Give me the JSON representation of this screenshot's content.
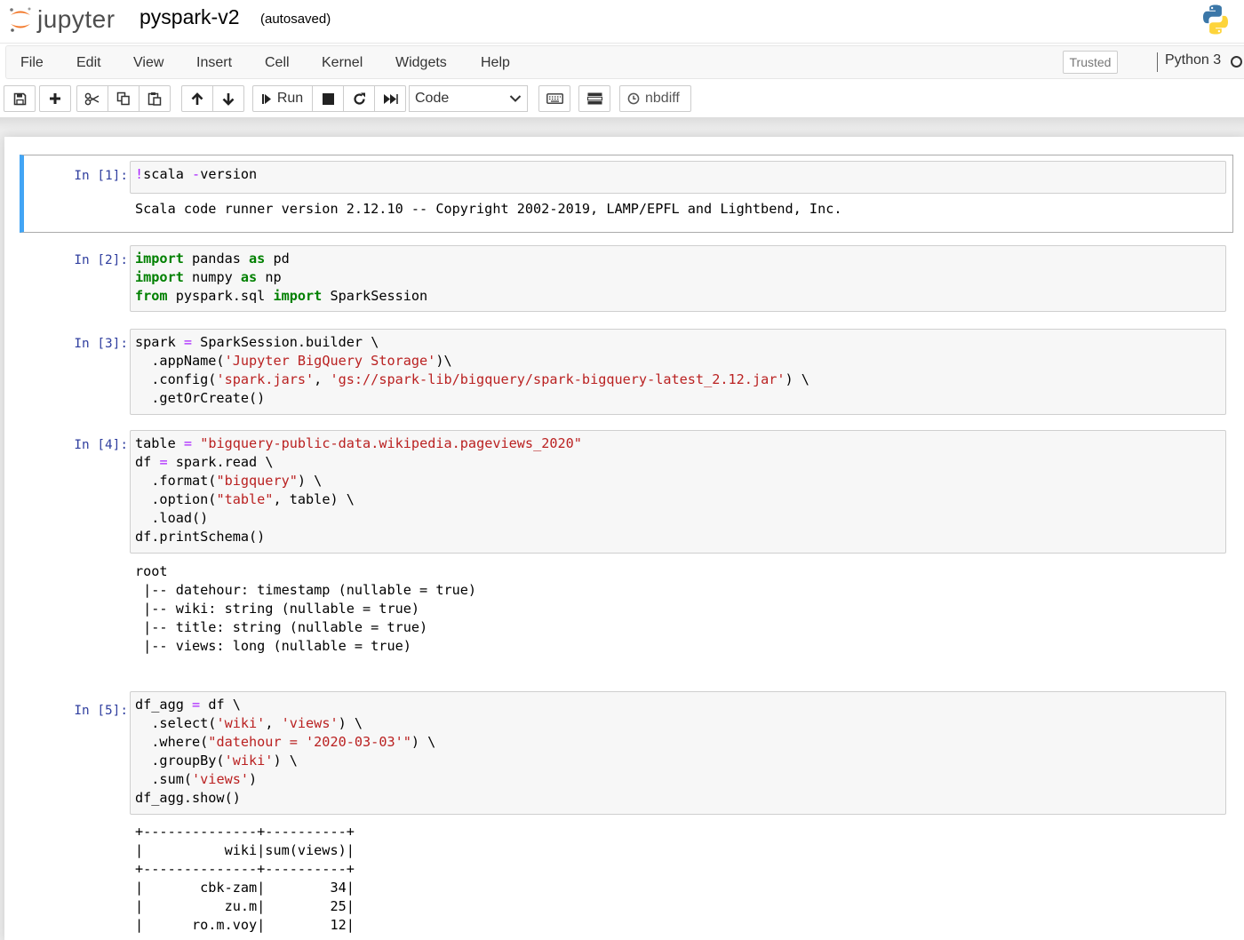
{
  "header": {
    "logo_text": "jupyter",
    "notebook_name": "pyspark-v2",
    "autosave_status": "(autosaved)"
  },
  "menu": {
    "items": [
      "File",
      "Edit",
      "View",
      "Insert",
      "Cell",
      "Kernel",
      "Widgets",
      "Help"
    ],
    "trusted": "Trusted",
    "kernel_name": "Python 3"
  },
  "toolbar": {
    "run_label": "Run",
    "cell_type": "Code",
    "nbdiff_label": "nbdiff"
  },
  "cells": [
    {
      "prompt": "In [1]:",
      "output": "Scala code runner version 2.12.10 -- Copyright 2002-2019, LAMP/EPFL and Lightbend, Inc."
    },
    {
      "prompt": "In [2]:"
    },
    {
      "prompt": "In [3]:"
    },
    {
      "prompt": "In [4]:",
      "output": "root\n |-- datehour: timestamp (nullable = true)\n |-- wiki: string (nullable = true)\n |-- title: string (nullable = true)\n |-- views: long (nullable = true)"
    },
    {
      "prompt": "In [5]:",
      "output": "+--------------+----------+\n|          wiki|sum(views)|\n+--------------+----------+\n|       cbk-zam|        34|\n|          zu.m|        25|\n|      ro.m.voy|        12|"
    }
  ],
  "colors": {
    "selected_cell_border": "#42a5f5",
    "prompt": "#303f9f",
    "keyword": "#008000",
    "string": "#ba2121",
    "operator": "#aa22ff"
  }
}
